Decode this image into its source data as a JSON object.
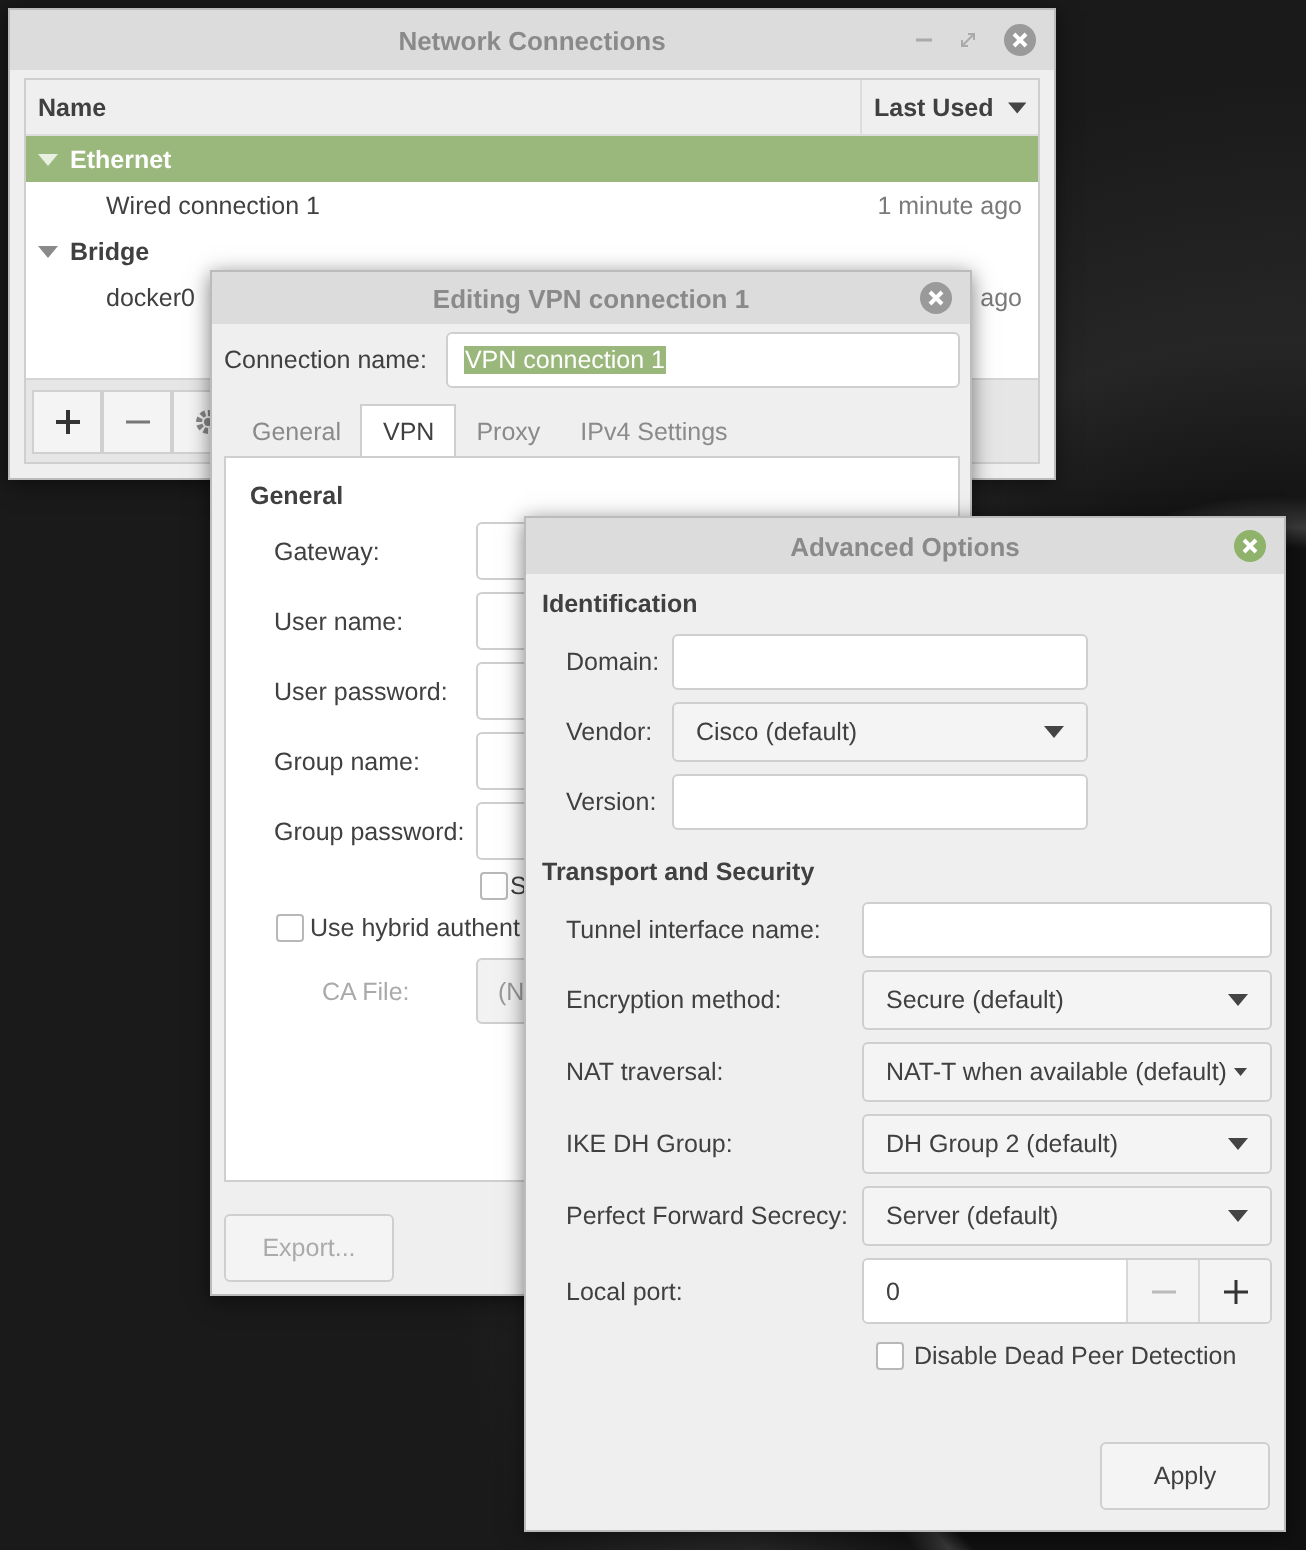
{
  "main_window": {
    "title": "Network Connections",
    "columns": [
      "Name",
      "Last Used"
    ],
    "groups": [
      {
        "name": "Ethernet",
        "expanded": true,
        "selected": true,
        "connections": [
          {
            "name": "Wired connection 1",
            "last_used": "1 minute ago"
          }
        ]
      },
      {
        "name": "Bridge",
        "expanded": true,
        "selected": false,
        "connections": [
          {
            "name": "docker0",
            "last_used": "ago"
          }
        ]
      }
    ]
  },
  "editor": {
    "title": "Editing VPN connection 1",
    "name_label": "Connection name:",
    "name_value": "VPN connection 1",
    "tabs": [
      {
        "label": "General",
        "selected": false
      },
      {
        "label": "VPN",
        "selected": true
      },
      {
        "label": "Proxy",
        "selected": false
      },
      {
        "label": "IPv4 Settings",
        "selected": false
      }
    ],
    "section": "General",
    "fields": [
      {
        "label": "Gateway:"
      },
      {
        "label": "User name:"
      },
      {
        "label": "User password:"
      },
      {
        "label": "Group name:"
      },
      {
        "label": "Group password:"
      }
    ],
    "show_check": {
      "label": "S",
      "checked": false
    },
    "hybrid_check": {
      "label": "Use hybrid authent",
      "checked": false
    },
    "ca_file": {
      "label": "CA File:",
      "value": "(N",
      "disabled": true
    },
    "export_button": {
      "label": "Export...",
      "disabled": true
    }
  },
  "advanced": {
    "title": "Advanced Options",
    "sections": [
      {
        "title": "Identification",
        "rows": [
          {
            "kind": "text",
            "label": "Domain:"
          },
          {
            "kind": "combo",
            "label": "Vendor:",
            "value": "Cisco (default)"
          },
          {
            "kind": "text",
            "label": "Version:"
          }
        ]
      },
      {
        "title": "Transport and Security",
        "rows": [
          {
            "kind": "text",
            "label": "Tunnel interface name:"
          },
          {
            "kind": "combo",
            "label": "Encryption method:",
            "value": "Secure (default)"
          },
          {
            "kind": "combo",
            "label": "NAT traversal:",
            "value": "NAT-T when available (default)"
          },
          {
            "kind": "combo",
            "label": "IKE DH Group:",
            "value": "DH Group 2 (default)"
          },
          {
            "kind": "combo",
            "label": "Perfect Forward Secrecy:",
            "value": "Server (default)"
          },
          {
            "kind": "spin",
            "label": "Local port:",
            "value": "0"
          }
        ]
      }
    ],
    "dpd_check": {
      "label": "Disable Dead Peer Detection",
      "checked": false
    },
    "apply_button": "Apply"
  }
}
